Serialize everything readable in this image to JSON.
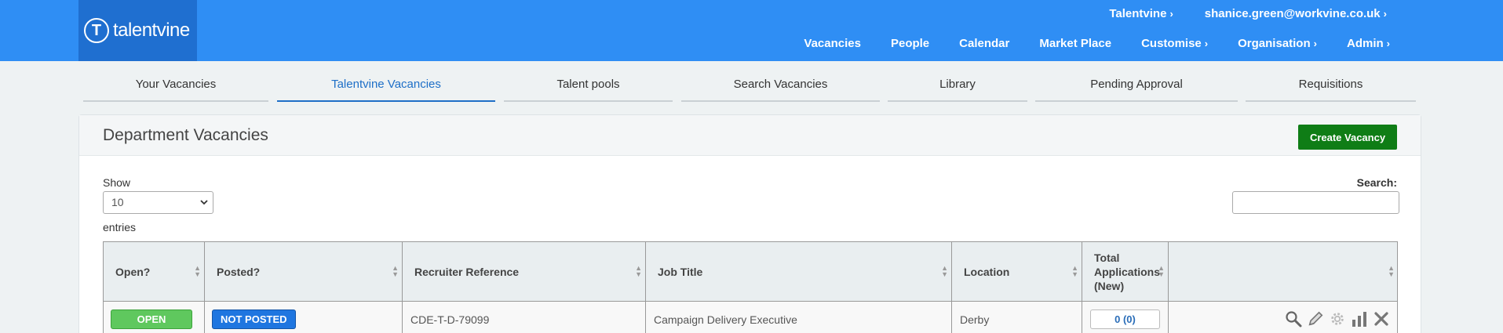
{
  "brand": {
    "name": "talentvine",
    "mark": "T"
  },
  "top_links": [
    {
      "label": "Talentvine"
    },
    {
      "label": "shanice.green@workvine.co.uk"
    }
  ],
  "main_nav": [
    {
      "label": "Vacancies",
      "chevron": false
    },
    {
      "label": "People",
      "chevron": false
    },
    {
      "label": "Calendar",
      "chevron": false
    },
    {
      "label": "Market Place",
      "chevron": false
    },
    {
      "label": "Customise",
      "chevron": true
    },
    {
      "label": "Organisation",
      "chevron": true
    },
    {
      "label": "Admin",
      "chevron": true
    }
  ],
  "tabs": [
    {
      "label": "Your Vacancies",
      "active": false
    },
    {
      "label": "Talentvine Vacancies",
      "active": true
    },
    {
      "label": "Talent pools",
      "active": false
    },
    {
      "label": "Search Vacancies",
      "active": false
    },
    {
      "label": "Library",
      "active": false
    },
    {
      "label": "Pending Approval",
      "active": false
    },
    {
      "label": "Requisitions",
      "active": false
    }
  ],
  "panel": {
    "title": "Department Vacancies",
    "create_label": "Create Vacancy",
    "show_label": "Show",
    "show_value": "10",
    "entries_label": "entries",
    "search_label": "Search:",
    "search_value": ""
  },
  "table": {
    "columns": [
      "Open?",
      "Posted?",
      "Recruiter Reference",
      "Job Title",
      "Location",
      "Total Applications (New)",
      ""
    ],
    "rows": [
      {
        "open": "OPEN",
        "posted": "NOT POSTED",
        "reference": "CDE-T-D-79099",
        "job_title": "Campaign Delivery Executive",
        "location": "Derby",
        "applications": "0 (0)"
      }
    ]
  },
  "colors": {
    "header": "#2f8ef4",
    "logo_bg": "#1f6fd0",
    "active_tab": "#1e6fc7",
    "create_button": "#0f7d16",
    "open_badge": "#5fc85e",
    "not_posted_badge": "#1f76e0"
  },
  "icons": [
    "search-icon",
    "pencil-icon",
    "gear-icon",
    "bar-chart-icon",
    "close-icon"
  ]
}
